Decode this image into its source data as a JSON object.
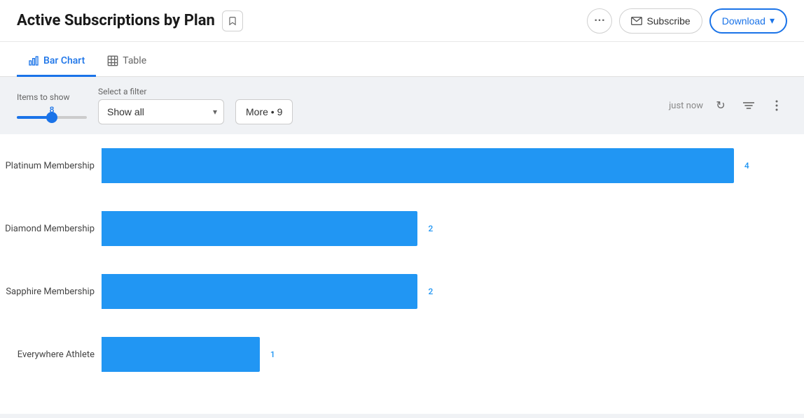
{
  "header": {
    "title": "Active Subscriptions by Plan",
    "bookmark_label": "🔖",
    "more_label": "···",
    "subscribe_label": "Subscribe",
    "download_label": "Download",
    "download_arrow": "▾"
  },
  "tabs": [
    {
      "id": "bar-chart",
      "label": "Bar Chart",
      "icon": "📊",
      "active": true
    },
    {
      "id": "table",
      "label": "Table",
      "icon": "⊞",
      "active": false
    }
  ],
  "controls": {
    "items_label": "Items to show",
    "items_value": "8",
    "filter_label": "Select a filter",
    "filter_option": "Show all",
    "more_filters_label": "More • 9",
    "timestamp": "just now",
    "refresh_icon": "↻",
    "filter_icon": "≡",
    "more_icon": "⋮"
  },
  "chart": {
    "bars": [
      {
        "label": "Platinum Membership",
        "value": 4,
        "max": 4,
        "pct": 100
      },
      {
        "label": "Diamond Membership",
        "value": 2,
        "max": 4,
        "pct": 49
      },
      {
        "label": "Sapphire Membership",
        "value": 2,
        "max": 4,
        "pct": 49
      },
      {
        "label": "Everywhere Athlete",
        "value": 1,
        "max": 4,
        "pct": 24
      }
    ]
  },
  "colors": {
    "accent": "#2196f3",
    "accent_border": "#1a73e8",
    "bar": "#2196f3"
  }
}
